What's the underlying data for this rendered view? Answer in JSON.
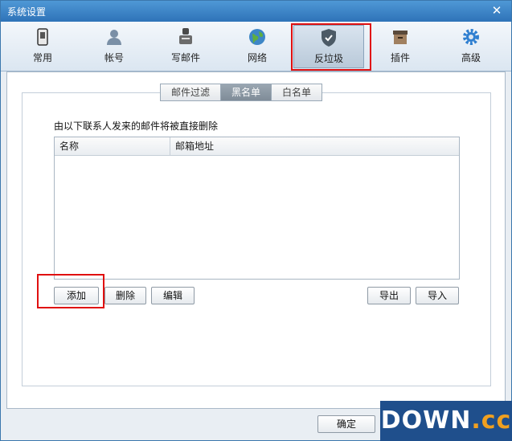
{
  "window": {
    "title": "系统设置",
    "close_icon": "close-icon"
  },
  "toolbar": {
    "items": [
      {
        "label": "常用",
        "icon": "phone-icon"
      },
      {
        "label": "帐号",
        "icon": "user-icon"
      },
      {
        "label": "写邮件",
        "icon": "writer-icon"
      },
      {
        "label": "网络",
        "icon": "globe-icon"
      },
      {
        "label": "反垃圾",
        "icon": "shield-icon"
      },
      {
        "label": "插件",
        "icon": "box-icon"
      },
      {
        "label": "高级",
        "icon": "gear-icon"
      }
    ],
    "active": "反垃圾"
  },
  "tabs": [
    {
      "label": "邮件过滤"
    },
    {
      "label": "黑名单"
    },
    {
      "label": "白名单"
    }
  ],
  "active_tab": "黑名单",
  "blacklist": {
    "description": "由以下联系人发来的邮件将被直接删除",
    "columns": [
      "名称",
      "邮箱地址"
    ],
    "rows": []
  },
  "buttons": {
    "add": "添加",
    "delete": "删除",
    "edit": "编辑",
    "export": "导出",
    "import": "导入",
    "ok": "确定"
  },
  "watermark": {
    "main": "DOWN",
    "suffix": ".cc"
  },
  "colors": {
    "highlight": "#e01010",
    "title_bar": "#2e73b8"
  }
}
